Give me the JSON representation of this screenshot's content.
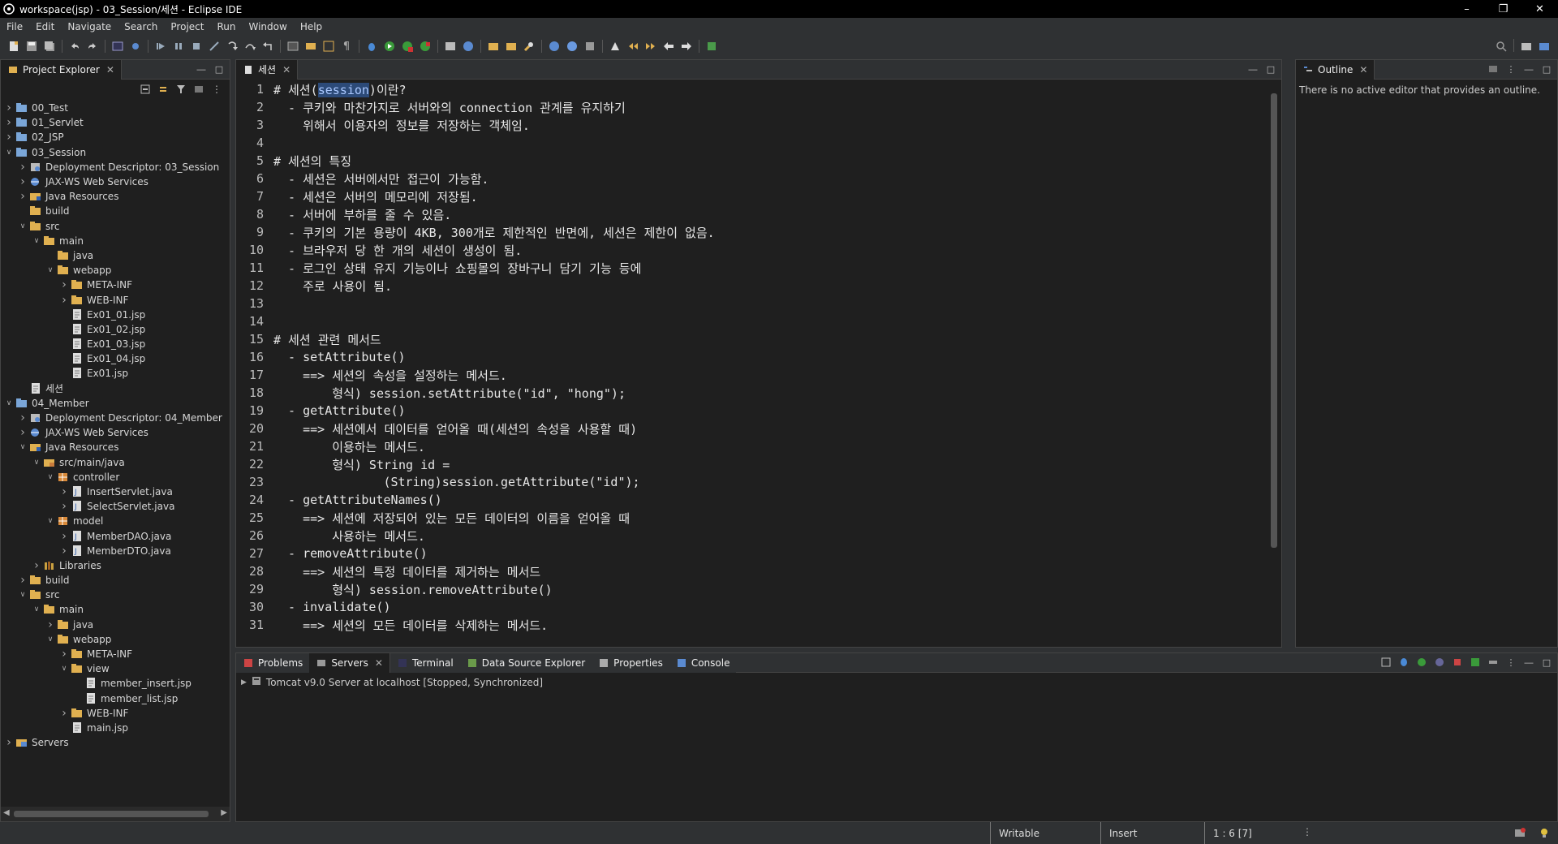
{
  "window": {
    "title": "workspace(jsp) - 03_Session/세션 - Eclipse IDE"
  },
  "menu": [
    "File",
    "Edit",
    "Navigate",
    "Search",
    "Project",
    "Run",
    "Window",
    "Help"
  ],
  "explorer": {
    "tab_label": "Project Explorer",
    "tree": [
      {
        "label": "00_Test",
        "depth": 0,
        "twisty": "closed",
        "icon": "project-icon"
      },
      {
        "label": "01_Servlet",
        "depth": 0,
        "twisty": "closed",
        "icon": "project-icon"
      },
      {
        "label": "02_JSP",
        "depth": 0,
        "twisty": "closed",
        "icon": "project-icon"
      },
      {
        "label": "03_Session",
        "depth": 0,
        "twisty": "open",
        "icon": "project-icon"
      },
      {
        "label": "Deployment Descriptor: 03_Session",
        "depth": 1,
        "twisty": "closed",
        "icon": "deployment-icon"
      },
      {
        "label": "JAX-WS Web Services",
        "depth": 1,
        "twisty": "closed",
        "icon": "webservice-icon"
      },
      {
        "label": "Java Resources",
        "depth": 1,
        "twisty": "closed",
        "icon": "java-resources-icon"
      },
      {
        "label": "build",
        "depth": 1,
        "twisty": "none",
        "icon": "folder-icon"
      },
      {
        "label": "src",
        "depth": 1,
        "twisty": "open",
        "icon": "folder-icon"
      },
      {
        "label": "main",
        "depth": 2,
        "twisty": "open",
        "icon": "folder-icon"
      },
      {
        "label": "java",
        "depth": 3,
        "twisty": "none",
        "icon": "folder-icon"
      },
      {
        "label": "webapp",
        "depth": 3,
        "twisty": "open",
        "icon": "folder-icon"
      },
      {
        "label": "META-INF",
        "depth": 4,
        "twisty": "closed",
        "icon": "folder-icon"
      },
      {
        "label": "WEB-INF",
        "depth": 4,
        "twisty": "closed",
        "icon": "folder-icon"
      },
      {
        "label": "Ex01_01.jsp",
        "depth": 4,
        "twisty": "none",
        "icon": "file-icon"
      },
      {
        "label": "Ex01_02.jsp",
        "depth": 4,
        "twisty": "none",
        "icon": "file-icon"
      },
      {
        "label": "Ex01_03.jsp",
        "depth": 4,
        "twisty": "none",
        "icon": "file-icon"
      },
      {
        "label": "Ex01_04.jsp",
        "depth": 4,
        "twisty": "none",
        "icon": "file-icon"
      },
      {
        "label": "Ex01.jsp",
        "depth": 4,
        "twisty": "none",
        "icon": "file-icon"
      },
      {
        "label": "세션",
        "depth": 1,
        "twisty": "none",
        "icon": "file-icon"
      },
      {
        "label": "04_Member",
        "depth": 0,
        "twisty": "open",
        "icon": "project-icon"
      },
      {
        "label": "Deployment Descriptor: 04_Member",
        "depth": 1,
        "twisty": "closed",
        "icon": "deployment-icon"
      },
      {
        "label": "JAX-WS Web Services",
        "depth": 1,
        "twisty": "closed",
        "icon": "webservice-icon"
      },
      {
        "label": "Java Resources",
        "depth": 1,
        "twisty": "open",
        "icon": "java-resources-icon"
      },
      {
        "label": "src/main/java",
        "depth": 2,
        "twisty": "open",
        "icon": "source-folder-icon"
      },
      {
        "label": "controller",
        "depth": 3,
        "twisty": "open",
        "icon": "package-icon"
      },
      {
        "label": "InsertServlet.java",
        "depth": 4,
        "twisty": "closed",
        "icon": "java-file-icon"
      },
      {
        "label": "SelectServlet.java",
        "depth": 4,
        "twisty": "closed",
        "icon": "java-file-icon"
      },
      {
        "label": "model",
        "depth": 3,
        "twisty": "open",
        "icon": "package-icon"
      },
      {
        "label": "MemberDAO.java",
        "depth": 4,
        "twisty": "closed",
        "icon": "java-file-icon"
      },
      {
        "label": "MemberDTO.java",
        "depth": 4,
        "twisty": "closed",
        "icon": "java-file-icon"
      },
      {
        "label": "Libraries",
        "depth": 2,
        "twisty": "closed",
        "icon": "library-icon"
      },
      {
        "label": "build",
        "depth": 1,
        "twisty": "closed",
        "icon": "folder-icon"
      },
      {
        "label": "src",
        "depth": 1,
        "twisty": "open",
        "icon": "folder-icon"
      },
      {
        "label": "main",
        "depth": 2,
        "twisty": "open",
        "icon": "folder-icon"
      },
      {
        "label": "java",
        "depth": 3,
        "twisty": "closed",
        "icon": "folder-icon"
      },
      {
        "label": "webapp",
        "depth": 3,
        "twisty": "open",
        "icon": "folder-icon"
      },
      {
        "label": "META-INF",
        "depth": 4,
        "twisty": "closed",
        "icon": "folder-icon"
      },
      {
        "label": "view",
        "depth": 4,
        "twisty": "open",
        "icon": "folder-icon"
      },
      {
        "label": "member_insert.jsp",
        "depth": 5,
        "twisty": "none",
        "icon": "file-icon"
      },
      {
        "label": "member_list.jsp",
        "depth": 5,
        "twisty": "none",
        "icon": "file-icon"
      },
      {
        "label": "WEB-INF",
        "depth": 4,
        "twisty": "closed",
        "icon": "folder-icon"
      },
      {
        "label": "main.jsp",
        "depth": 4,
        "twisty": "none",
        "icon": "file-icon"
      },
      {
        "label": "Servers",
        "depth": 0,
        "twisty": "closed",
        "icon": "servers-folder-icon"
      }
    ]
  },
  "editor": {
    "tab_label": "세션",
    "lines": [
      {
        "n": "1",
        "fold": "",
        "pre": "# 세션(",
        "sel": "session",
        "post": ")이란?"
      },
      {
        "n": "2",
        "fold": "",
        "text": "  - 쿠키와 마찬가지로 서버와의 connection 관계를 유지하기"
      },
      {
        "n": "3",
        "fold": "",
        "text": "    위해서 이용자의 정보를 저장하는 객체임."
      },
      {
        "n": "4",
        "fold": "",
        "text": ""
      },
      {
        "n": "5",
        "fold": "",
        "text": "# 세션의 특징"
      },
      {
        "n": "6",
        "fold": "",
        "text": "  - 세션은 서버에서만 접근이 가능함."
      },
      {
        "n": "7",
        "fold": "",
        "text": "  - 세션은 서버의 메모리에 저장됨."
      },
      {
        "n": "8",
        "fold": "",
        "text": "  - 서버에 부하를 줄 수 있음."
      },
      {
        "n": "9",
        "fold": "",
        "text": "  - 쿠키의 기본 용량이 4KB, 300개로 제한적인 반면에, 세션은 제한이 없음."
      },
      {
        "n": "10",
        "fold": "",
        "text": "  - 브라우저 당 한 개의 세션이 생성이 됨."
      },
      {
        "n": "11",
        "fold": "",
        "text": "  - 로그인 상태 유지 기능이나 쇼핑몰의 장바구니 담기 기능 등에"
      },
      {
        "n": "12",
        "fold": "",
        "text": "    주로 사용이 됨."
      },
      {
        "n": "13",
        "fold": "",
        "text": ""
      },
      {
        "n": "14",
        "fold": "",
        "text": ""
      },
      {
        "n": "15",
        "fold": "",
        "text": "# 세션 관련 메서드"
      },
      {
        "n": "16",
        "fold": "",
        "text": "  - setAttribute()"
      },
      {
        "n": "17",
        "fold": "",
        "text": "    ==> 세션의 속성을 설정하는 메서드."
      },
      {
        "n": "18",
        "fold": "",
        "text": "        형식) session.setAttribute(\"id\", \"hong\");"
      },
      {
        "n": "19",
        "fold": "",
        "text": "  - getAttribute()"
      },
      {
        "n": "20",
        "fold": "",
        "text": "    ==> 세션에서 데이터를 얻어올 때(세션의 속성을 사용할 때)"
      },
      {
        "n": "21",
        "fold": "",
        "text": "        이용하는 메서드."
      },
      {
        "n": "22",
        "fold": "",
        "text": "        형식) String id ="
      },
      {
        "n": "23",
        "fold": "",
        "text": "               (String)session.getAttribute(\"id\");"
      },
      {
        "n": "24",
        "fold": "",
        "text": "  - getAttributeNames()"
      },
      {
        "n": "25",
        "fold": "",
        "text": "    ==> 세션에 저장되어 있는 모든 데이터의 이름을 얻어올 때"
      },
      {
        "n": "26",
        "fold": "",
        "text": "        사용하는 메서드."
      },
      {
        "n": "27",
        "fold": "",
        "text": "  - removeAttribute()"
      },
      {
        "n": "28",
        "fold": "",
        "text": "    ==> 세션의 특정 데이터를 제거하는 메서드"
      },
      {
        "n": "29",
        "fold": "",
        "text": "        형식) session.removeAttribute()"
      },
      {
        "n": "30",
        "fold": "",
        "text": "  - invalidate()"
      },
      {
        "n": "31",
        "fold": "",
        "text": "    ==> 세션의 모든 데이터를 삭제하는 메서드."
      }
    ]
  },
  "outline": {
    "tab_label": "Outline",
    "message": "There is no active editor that provides an outline."
  },
  "bottom": {
    "tabs": [
      {
        "label": "Problems",
        "icon": "problems-icon",
        "active": false
      },
      {
        "label": "Servers",
        "icon": "servers-icon",
        "active": true
      },
      {
        "label": "Terminal",
        "icon": "terminal-icon",
        "active": false
      },
      {
        "label": "Data Source Explorer",
        "icon": "datasource-icon",
        "active": false
      },
      {
        "label": "Properties",
        "icon": "properties-icon",
        "active": false
      },
      {
        "label": "Console",
        "icon": "console-icon",
        "active": false
      }
    ],
    "server": "Tomcat v9.0 Server at localhost  [Stopped, Synchronized]"
  },
  "status": {
    "writable": "Writable",
    "insert": "Insert",
    "position": "1 : 6 [7]"
  },
  "colors": {
    "folder": "#e0b050",
    "project": "#7aa6d8",
    "accent": "#2c4a78"
  }
}
